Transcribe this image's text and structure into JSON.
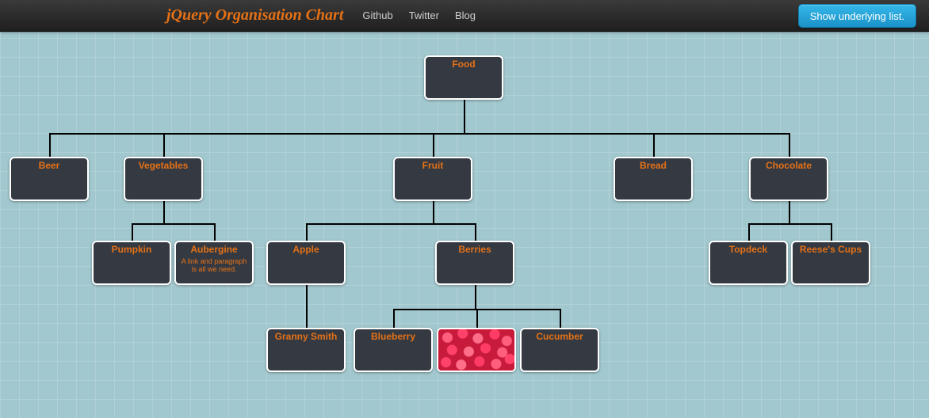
{
  "header": {
    "brand": "jQuery Organisation Chart",
    "links": [
      "Github",
      "Twitter",
      "Blog"
    ],
    "button": "Show underlying list."
  },
  "nodes": {
    "food": "Food",
    "beer": "Beer",
    "vegetables": "Vegetables",
    "fruit": "Fruit",
    "bread": "Bread",
    "chocolate": "Chocolate",
    "pumpkin": "Pumpkin",
    "aubergine": {
      "title": "Aubergine",
      "sub": "A link and paragraph is all we need."
    },
    "apple": "Apple",
    "berries": "Berries",
    "topdeck": "Topdeck",
    "reeses": "Reese's Cups",
    "granny": "Granny Smith",
    "blueberry": "Blueberry",
    "raspberry_alt": "Raspberries (image)",
    "cucumber": "Cucumber"
  },
  "hierarchy": {
    "Food": {
      "Beer": {},
      "Vegetables": {
        "Pumpkin": {},
        "Aubergine": {}
      },
      "Fruit": {
        "Apple": {
          "Granny Smith": {}
        },
        "Berries": {
          "Blueberry": {},
          "Raspberry (image)": {},
          "Cucumber": {}
        }
      },
      "Bread": {},
      "Chocolate": {
        "Topdeck": {},
        "Reese's Cups": {}
      }
    }
  },
  "colors": {
    "accent": "#e57116",
    "node_bg": "#353a42",
    "page_bg": "#a2c8cf"
  }
}
